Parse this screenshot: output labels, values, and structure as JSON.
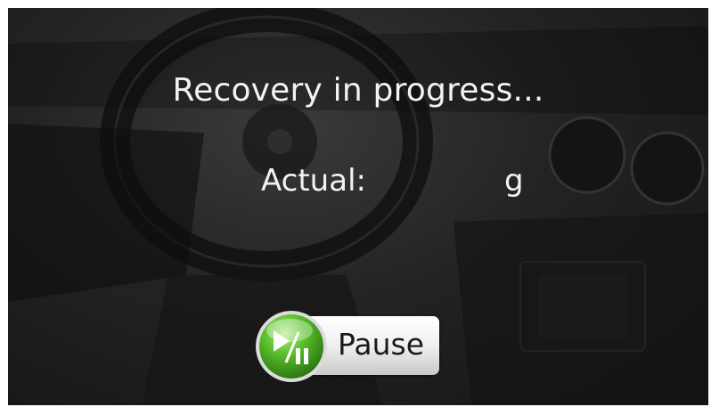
{
  "status": {
    "title": "Recovery in progress..."
  },
  "reading": {
    "label": "Actual:",
    "value": "",
    "unit": "g"
  },
  "controls": {
    "pause_label": "Pause",
    "pause_icon": "play-pause-icon"
  },
  "colors": {
    "background": "#1c1c1c",
    "text": "#f2f2f2",
    "button_green": "#4caf28"
  }
}
